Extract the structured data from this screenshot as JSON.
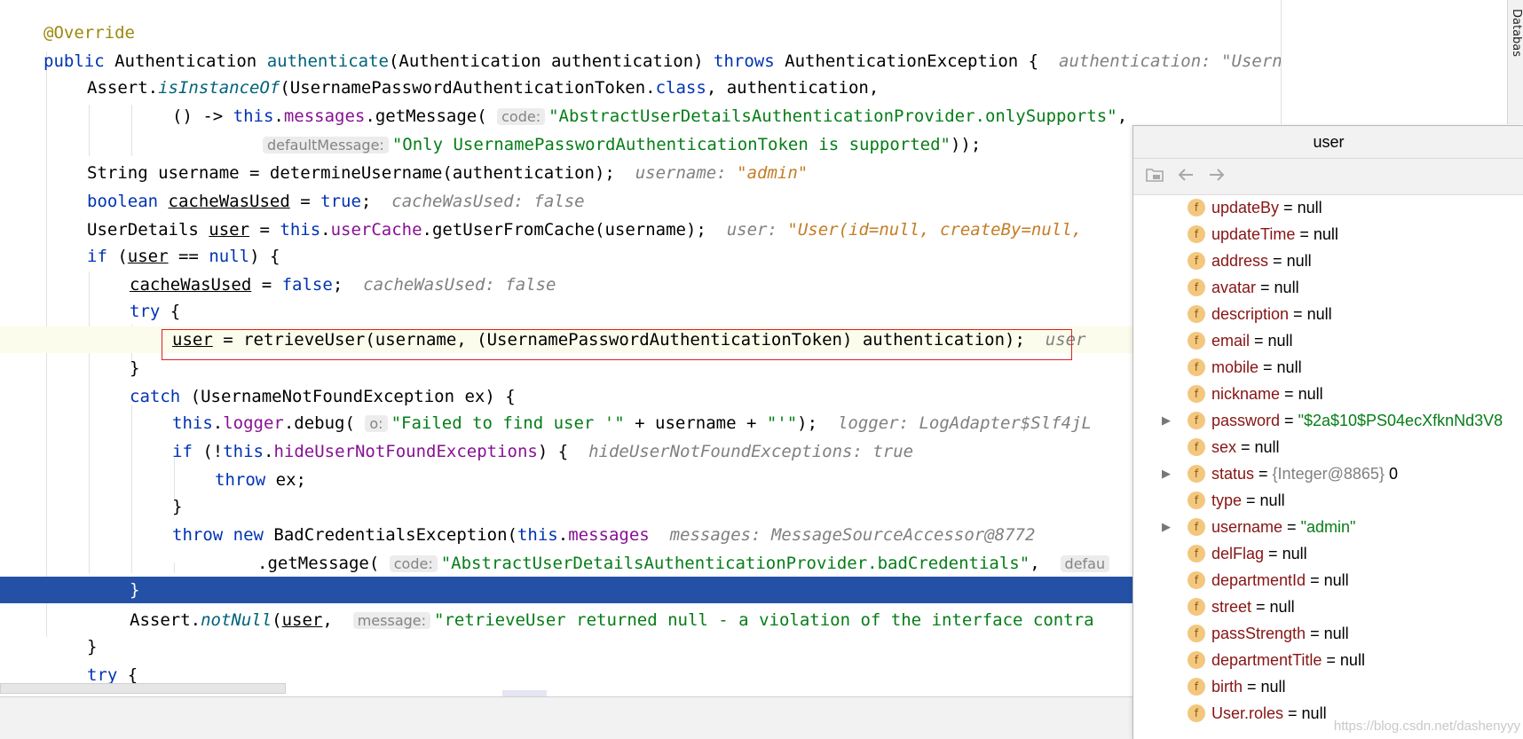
{
  "editor": {
    "lines": [
      {
        "t": "ann_line",
        "text": "@Override"
      },
      {
        "kw1": "public",
        "type1": "Authentication",
        "fn": "authenticate",
        "args": "(Authentication authentication)",
        "kw2": "throws",
        "rest": "AuthenticationException {",
        "hint_label": "authentication:",
        "hint_value": "\"UsernamePasswordAuthe"
      },
      {
        "pre": "Assert.",
        "fn": "isInstanceOf",
        "args": "(UsernamePasswordAuthenticationToken.",
        "kw": "class",
        "post": ", authentication,"
      },
      {
        "pre": "() -> ",
        "kw": "this",
        "dot": ".",
        "fld": "messages",
        "call": ".getMessage(",
        "ph": "code:",
        "str": "\"AbstractUserDetailsAuthenticationProvider.onlySupports\"",
        "post": ","
      },
      {
        "ph": "defaultMessage:",
        "str": "\"Only UsernamePasswordAuthenticationToken is supported\"",
        "post": "));"
      },
      {
        "pre": "String username = determineUsername(authentication);",
        "hint_label": "username:",
        "hint_value": "\"admin\""
      },
      {
        "kw": "boolean",
        "var": "cacheWasUsed",
        "post": " = ",
        "kw2": "true",
        "post2": ";",
        "hint": "cacheWasUsed: false"
      },
      {
        "pre": "UserDetails ",
        "var": "user",
        "mid": " = ",
        "kw": "this",
        "dot": ".",
        "fld": "userCache",
        "post": ".getUserFromCache(username);",
        "hint_label": "user:",
        "hint_value": "\"User(id=null, createBy=null,"
      },
      {
        "kw": "if",
        "pre": " (",
        "var": "user",
        "post": " == ",
        "kw2": "null",
        "post2": ") {"
      },
      {
        "var": "cacheWasUsed",
        "post": " = ",
        "kw": "false",
        "post2": ";",
        "hint": "cacheWasUsed: false"
      },
      {
        "kw": "try",
        "post": " {"
      },
      {
        "var": "user",
        "post": " = retrieveUser(username, (UsernamePasswordAuthenticationToken) authentication);",
        "hint": "user"
      },
      {
        "post": "}"
      },
      {
        "kw": "catch",
        "post": " (UsernameNotFoundException ex) {"
      },
      {
        "kw": "this",
        "dot": ".",
        "fld": "logger",
        "call": ".debug(",
        "ph": "o:",
        "str": "\"Failed to find user '\"",
        "mid": " + username + ",
        "str2": "\"'\"",
        "post": ");",
        "hint": "logger: LogAdapter$Slf4jL"
      },
      {
        "kw": "if",
        "pre": " (!",
        "kw2": "this",
        "dot": ".",
        "fld": "hideUserNotFoundExceptions",
        "post": ") {",
        "hint": "hideUserNotFoundExceptions: true"
      },
      {
        "kw": "throw",
        "post": " ex;"
      },
      {
        "post": "}"
      },
      {
        "kw": "throw",
        "kw2": "new",
        "pre": " BadCredentialsException(",
        "kw3": "this",
        "dot": ".",
        "fld": "messages",
        "hint": "messages: MessageSourceAccessor@8772"
      },
      {
        "pre": ".getMessage(",
        "ph": "code:",
        "str": "\"AbstractUserDetailsAuthenticationProvider.badCredentials\"",
        "post": ",",
        "ph2": "defau"
      },
      {
        "post": "}"
      },
      {
        "pre": "Assert.",
        "fn": "notNull",
        "args": "(",
        "var": "user",
        "post": ",",
        "ph": "message:",
        "str": "\"retrieveUser returned null - a violation of the interface contra"
      },
      {
        "post": "}"
      },
      {
        "kw": "try",
        "post": " {"
      }
    ]
  },
  "popup": {
    "title": "user",
    "toolbar": [
      "folder-icon",
      "back-arrow-icon",
      "forward-arrow-icon"
    ],
    "fields": [
      {
        "name": "updateBy",
        "eq": " = ",
        "value": "null",
        "kind": "null",
        "expand": false
      },
      {
        "name": "updateTime",
        "eq": " = ",
        "value": "null",
        "kind": "null",
        "expand": false
      },
      {
        "name": "address",
        "eq": " = ",
        "value": "null",
        "kind": "null",
        "expand": false
      },
      {
        "name": "avatar",
        "eq": " = ",
        "value": "null",
        "kind": "null",
        "expand": false
      },
      {
        "name": "description",
        "eq": " = ",
        "value": "null",
        "kind": "null",
        "expand": false
      },
      {
        "name": "email",
        "eq": " = ",
        "value": "null",
        "kind": "null",
        "expand": false
      },
      {
        "name": "mobile",
        "eq": " = ",
        "value": "null",
        "kind": "null",
        "expand": false
      },
      {
        "name": "nickname",
        "eq": " = ",
        "value": "null",
        "kind": "null",
        "expand": false
      },
      {
        "name": "password",
        "eq": " = ",
        "value": "\"$2a$10$PS04ecXfknNd3V8",
        "kind": "str",
        "expand": true
      },
      {
        "name": "sex",
        "eq": " = ",
        "value": "null",
        "kind": "null",
        "expand": false
      },
      {
        "name": "status",
        "eq": " = ",
        "obj": "{Integer@8865}",
        "value": " 0",
        "kind": "obj",
        "expand": true
      },
      {
        "name": "type",
        "eq": " = ",
        "value": "null",
        "kind": "null",
        "expand": false
      },
      {
        "name": "username",
        "eq": " = ",
        "value": "\"admin\"",
        "kind": "str",
        "expand": true
      },
      {
        "name": "delFlag",
        "eq": " = ",
        "value": "null",
        "kind": "null",
        "expand": false
      },
      {
        "name": "departmentId",
        "eq": " = ",
        "value": "null",
        "kind": "null",
        "expand": false
      },
      {
        "name": "street",
        "eq": " = ",
        "value": "null",
        "kind": "null",
        "expand": false
      },
      {
        "name": "passStrength",
        "eq": " = ",
        "value": "null",
        "kind": "null",
        "expand": false
      },
      {
        "name": "departmentTitle",
        "eq": " = ",
        "value": "null",
        "kind": "null",
        "expand": false
      },
      {
        "name": "birth",
        "eq": " = ",
        "value": "null",
        "kind": "null",
        "expand": false
      },
      {
        "name": "User.roles",
        "eq": " = ",
        "value": "null",
        "kind": "null",
        "expand": false
      }
    ],
    "field_icon": "f",
    "expand_glyph": "▶"
  },
  "side_tab": "Databas",
  "corner_tab": "n",
  "watermark": "https://blog.csdn.net/dashenyyy",
  "colors": {
    "keyword": "#0033b3",
    "string": "#067d17",
    "field": "#871094",
    "annotation": "#9e880d",
    "exec_line": "#2451a5",
    "red_box": "#e02020"
  }
}
